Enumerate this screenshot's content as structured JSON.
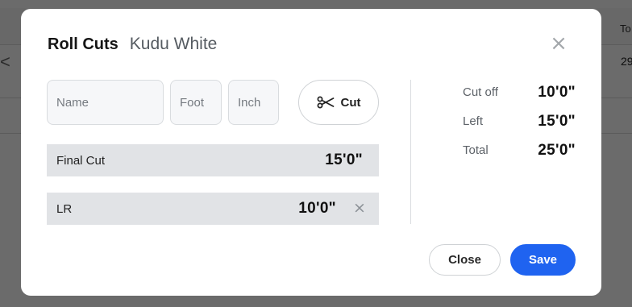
{
  "background": {
    "column_label": "To",
    "row_chevron": "<",
    "row_value": "29"
  },
  "modal": {
    "title": "Roll Cuts",
    "subtitle": "Kudu White",
    "close_icon": "close-icon",
    "inputs": {
      "name": {
        "placeholder": "Name",
        "value": ""
      },
      "foot": {
        "placeholder": "Foot",
        "value": ""
      },
      "inch": {
        "placeholder": "Inch",
        "value": ""
      }
    },
    "cut_button": {
      "label": "Cut",
      "icon": "scissors-icon"
    },
    "rows": [
      {
        "name": "Final Cut",
        "value": "15'0\"",
        "removable": false
      },
      {
        "name": "LR",
        "value": "10'0\"",
        "removable": true
      }
    ],
    "summary": {
      "cut_off": {
        "label": "Cut off",
        "value": "10'0\""
      },
      "left": {
        "label": "Left",
        "value": "15'0\""
      },
      "total": {
        "label": "Total",
        "value": "25'0\""
      }
    },
    "buttons": {
      "close": "Close",
      "save": "Save"
    }
  },
  "colors": {
    "primary": "#1f63f0",
    "row_background": "#e1e3e6",
    "input_background": "#f6f7f9"
  }
}
